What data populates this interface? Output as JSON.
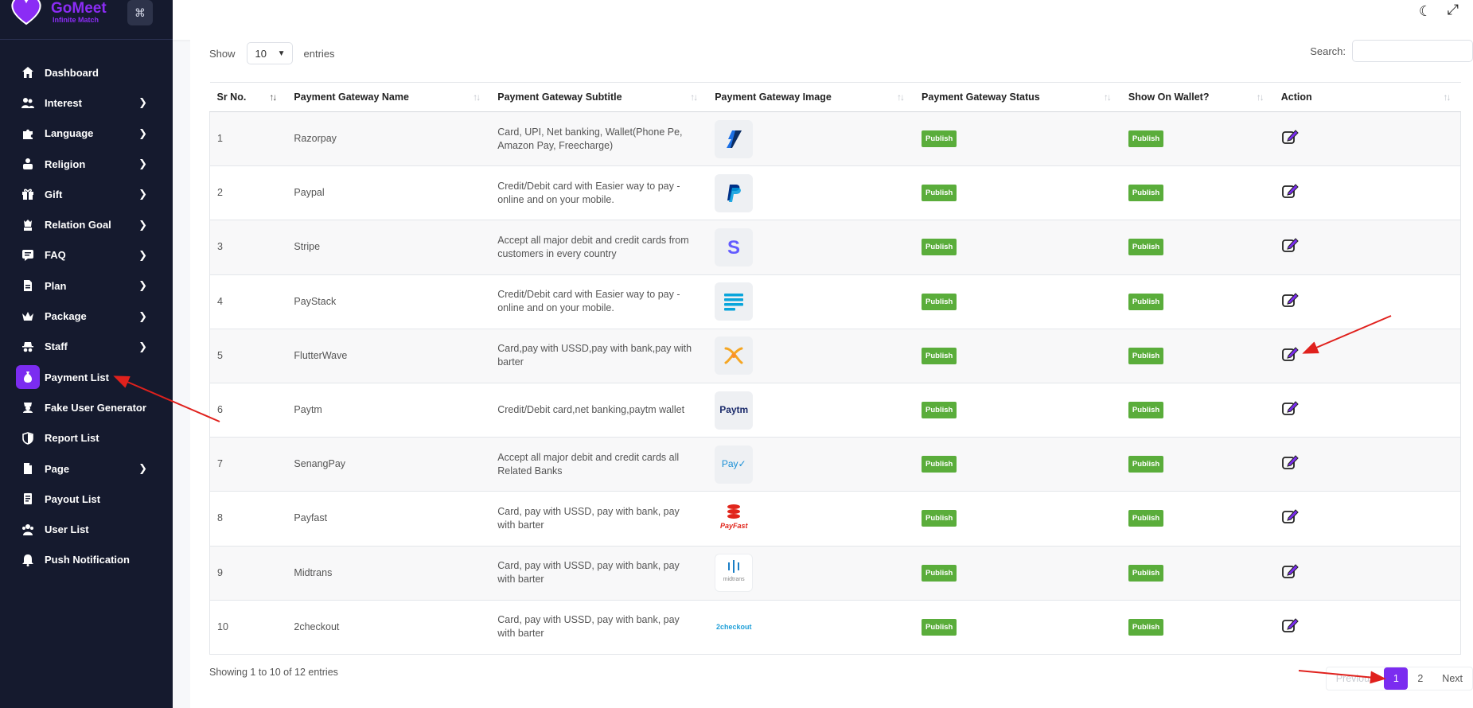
{
  "brand": {
    "name": "GoMeet",
    "subtitle": "Infinite Match",
    "grid_icon": "grid-icon"
  },
  "sidebar": {
    "items": [
      {
        "label": "Dashboard",
        "icon": "home-icon",
        "has_chevron": false
      },
      {
        "label": "Interest",
        "icon": "users-icon",
        "has_chevron": true
      },
      {
        "label": "Language",
        "icon": "puzzle-icon",
        "has_chevron": true
      },
      {
        "label": "Religion",
        "icon": "religion-icon",
        "has_chevron": true
      },
      {
        "label": "Gift",
        "icon": "gift-icon",
        "has_chevron": true
      },
      {
        "label": "Relation Goal",
        "icon": "chess-icon",
        "has_chevron": true
      },
      {
        "label": "FAQ",
        "icon": "faq-icon",
        "has_chevron": true
      },
      {
        "label": "Plan",
        "icon": "plan-icon",
        "has_chevron": true
      },
      {
        "label": "Package",
        "icon": "crown-icon",
        "has_chevron": true
      },
      {
        "label": "Staff",
        "icon": "spy-icon",
        "has_chevron": true
      },
      {
        "label": "Payment List",
        "icon": "money-bag-icon",
        "has_chevron": false,
        "active": true
      },
      {
        "label": "Fake User Generator",
        "icon": "fake-user-icon",
        "has_chevron": false
      },
      {
        "label": "Report List",
        "icon": "shield-icon",
        "has_chevron": false
      },
      {
        "label": "Page",
        "icon": "page-icon",
        "has_chevron": true
      },
      {
        "label": "Payout List",
        "icon": "payout-icon",
        "has_chevron": false
      },
      {
        "label": "User List",
        "icon": "user-list-icon",
        "has_chevron": false
      },
      {
        "label": "Push Notification",
        "icon": "bell-icon",
        "has_chevron": false
      }
    ]
  },
  "header": {
    "theme_icon": "moon-icon",
    "fullscreen_icon": "expand-icon"
  },
  "table_controls": {
    "show_label": "Show",
    "entries_value": "10",
    "entries_label": "entries",
    "search_label": "Search:",
    "search_value": ""
  },
  "table": {
    "columns": [
      "Sr No.",
      "Payment Gateway Name",
      "Payment Gateway Subtitle",
      "Payment Gateway Image",
      "Payment Gateway Status",
      "Show On Wallet?",
      "Action"
    ],
    "rows": [
      {
        "sr": "1",
        "name": "Razorpay",
        "subtitle": "Card, UPI, Net banking, Wallet(Phone Pe, Amazon Pay, Freecharge)",
        "image": "razorpay-logo",
        "status": "Publish",
        "wallet": "Publish"
      },
      {
        "sr": "2",
        "name": "Paypal",
        "subtitle": "Credit/Debit card with Easier way to pay - online and on your mobile.",
        "image": "paypal-logo",
        "status": "Publish",
        "wallet": "Publish"
      },
      {
        "sr": "3",
        "name": "Stripe",
        "subtitle": "Accept all major debit and credit cards from customers in every country",
        "image": "stripe-logo",
        "status": "Publish",
        "wallet": "Publish"
      },
      {
        "sr": "4",
        "name": "PayStack",
        "subtitle": "Credit/Debit card with Easier way to pay - online and on your mobile.",
        "image": "paystack-logo",
        "status": "Publish",
        "wallet": "Publish"
      },
      {
        "sr": "5",
        "name": "FlutterWave",
        "subtitle": "Card,pay with USSD,pay with bank,pay with barter",
        "image": "flutterwave-logo",
        "status": "Publish",
        "wallet": "Publish"
      },
      {
        "sr": "6",
        "name": "Paytm",
        "subtitle": "Credit/Debit card,net banking,paytm wallet",
        "image": "paytm-logo",
        "status": "Publish",
        "wallet": "Publish"
      },
      {
        "sr": "7",
        "name": "SenangPay",
        "subtitle": "Accept all major debit and credit cards all Related Banks",
        "image": "senangpay-logo",
        "status": "Publish",
        "wallet": "Publish"
      },
      {
        "sr": "8",
        "name": "Payfast",
        "subtitle": "Card, pay with USSD, pay with bank, pay with barter",
        "image": "payfast-logo",
        "status": "Publish",
        "wallet": "Publish"
      },
      {
        "sr": "9",
        "name": "Midtrans",
        "subtitle": "Card, pay with USSD, pay with bank, pay with barter",
        "image": "midtrans-logo",
        "status": "Publish",
        "wallet": "Publish"
      },
      {
        "sr": "10",
        "name": "2checkout",
        "subtitle": "Card, pay with USSD, pay with bank, pay with barter",
        "image": "2checkout-logo",
        "status": "Publish",
        "wallet": "Publish"
      }
    ],
    "logo_text": {
      "paytm": "Paytm",
      "senang": "Pay✓",
      "payfast": "PayFast",
      "midtrans": "midtrans",
      "twocheckout": "2checkout"
    }
  },
  "footer": {
    "info": "Showing 1 to 10 of 12 entries",
    "pagination": {
      "previous": "Previous",
      "pages": [
        "1",
        "2"
      ],
      "current": "1",
      "next": "Next"
    }
  },
  "colors": {
    "sidebar_bg": "#151a2e",
    "accent": "#7b2cf0",
    "badge_green": "#5aad3b",
    "annotation_red": "#e0211d"
  }
}
